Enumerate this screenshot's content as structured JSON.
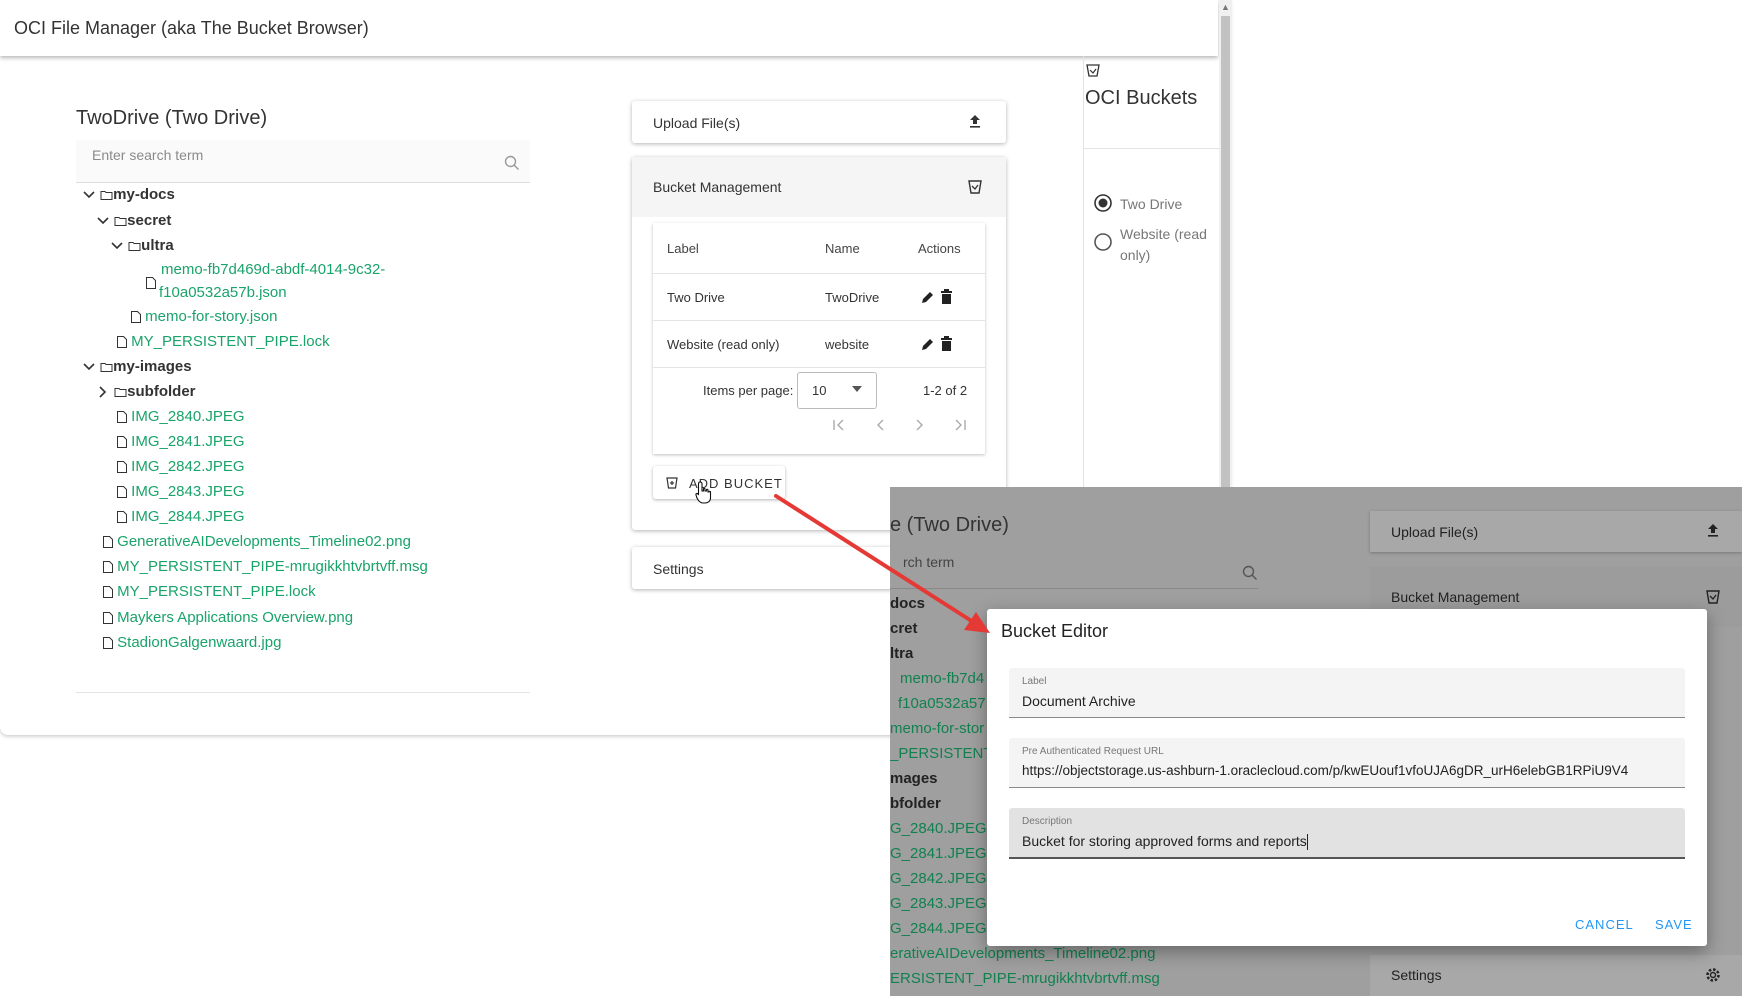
{
  "app": {
    "title": "OCI File Manager (aka The Bucket Browser)"
  },
  "drive": {
    "title": "TwoDrive (Two Drive)",
    "search_placeholder": "Enter search term"
  },
  "tree": {
    "my_docs": "my-docs",
    "secret": "secret",
    "ultra": "ultra",
    "memo_line1": "memo-fb7d469d-abdf-4014-9c32-",
    "memo_line2": "f10a0532a57b.json",
    "memo_for_story": "memo-for-story.json",
    "persistent_lock_docs": "MY_PERSISTENT_PIPE.lock",
    "my_images": "my-images",
    "subfolder": "subfolder",
    "img1": "IMG_2840.JPEG",
    "img2": "IMG_2841.JPEG",
    "img3": "IMG_2842.JPEG",
    "img4": "IMG_2843.JPEG",
    "img5": "IMG_2844.JPEG",
    "genai": "GenerativeAIDevelopments_Timeline02.png",
    "msg": "MY_PERSISTENT_PIPE-mrugikkhtvbrtvff.msg",
    "persistent_lock": "MY_PERSISTENT_PIPE.lock",
    "maykers": "Maykers Applications Overview.png",
    "stadion": "StadionGalgenwaard.jpg"
  },
  "upload": {
    "label": "Upload File(s)"
  },
  "bucket_mgmt": {
    "label": "Bucket Management",
    "columns": [
      "Label",
      "Name",
      "Actions"
    ],
    "rows": [
      {
        "label": "Two Drive",
        "name": "TwoDrive"
      },
      {
        "label": "Website (read only)",
        "name": "website"
      }
    ],
    "items_per_page_label": "Items per page:",
    "items_per_page_value": "10",
    "range": "1-2 of 2",
    "add_bucket": "ADD BUCKET"
  },
  "settings": {
    "label": "Settings"
  },
  "oci_buckets": {
    "title": "OCI Buckets",
    "options": [
      "Two Drive",
      "Website (read",
      "only)"
    ]
  },
  "overlay": {
    "drive_title_partial": "e (Two Drive)",
    "search_partial": "rch term",
    "upload": "Upload File(s)",
    "bucket_mgmt": "Bucket Management",
    "settings": "Settings",
    "tree": {
      "docs": "docs",
      "cret": "cret",
      "ltra": "ltra",
      "memo1": "memo-fb7d4",
      "memo2": "f10a0532a57",
      "memo_story": "memo-for-stor",
      "persistent": "_PERSISTENT",
      "mages": "mages",
      "bfolder": "bfolder",
      "g1": "G_2840.JPEG",
      "g2": "G_2841.JPEG",
      "g3": "G_2842.JPEG",
      "g4": "G_2843.JPEG",
      "g5": "G_2844.JPEG",
      "genai": "erativeAIDevelopments_Timeline02.png",
      "msg": "ERSISTENT_PIPE-mrugikkhtvbrtvff.msg"
    }
  },
  "dialog": {
    "title": "Bucket Editor",
    "label_field": {
      "label": "Label",
      "value": "Document Archive"
    },
    "url_field": {
      "label": "Pre Authenticated Request URL",
      "value": "https://objectstorage.us-ashburn-1.oraclecloud.com/p/kwEUouf1vfoUJA6gDR_urH6elebGB1RPiU9V4"
    },
    "desc_field": {
      "label": "Description",
      "value": "Bucket for storing approved forms and reports"
    },
    "cancel": "CANCEL",
    "save": "SAVE"
  },
  "colors": {
    "file_green": "#1aa36a",
    "accent_blue": "#2196f3",
    "arrow_red": "#e53935"
  }
}
